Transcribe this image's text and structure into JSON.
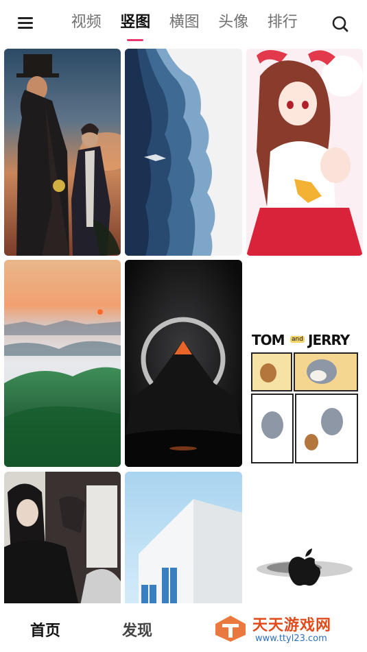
{
  "header": {
    "menu_icon": "hamburger-icon",
    "search_icon": "search-icon",
    "tabs": [
      {
        "label": "视频",
        "active": false
      },
      {
        "label": "竖图",
        "active": true
      },
      {
        "label": "横图",
        "active": false
      },
      {
        "label": "头像",
        "active": false
      },
      {
        "label": "排行",
        "active": false
      }
    ],
    "active_tab_color": "#e8386c"
  },
  "wallpapers": [
    {
      "label": "dark fantasy figures at sunset"
    },
    {
      "label": "blue abstract waves with whale"
    },
    {
      "label": "anime girl in red and white outfit"
    },
    {
      "label": "mountains above sea of clouds at sunrise"
    },
    {
      "label": "dark mountain with glowing ring"
    },
    {
      "label": "Tom and Jerry comic"
    },
    {
      "label": "anime man in black robe"
    },
    {
      "label": "white building with blue window shutters"
    },
    {
      "label": "apple logo ink splash"
    }
  ],
  "tom_jerry_title": "TOM",
  "tom_jerry_title2": "JERRY",
  "tom_jerry_and": "and",
  "bottom_nav": {
    "home": "首页",
    "discover": "发现"
  },
  "watermark": {
    "title": "天天游戏网",
    "url": "www.ttyl23.com"
  }
}
